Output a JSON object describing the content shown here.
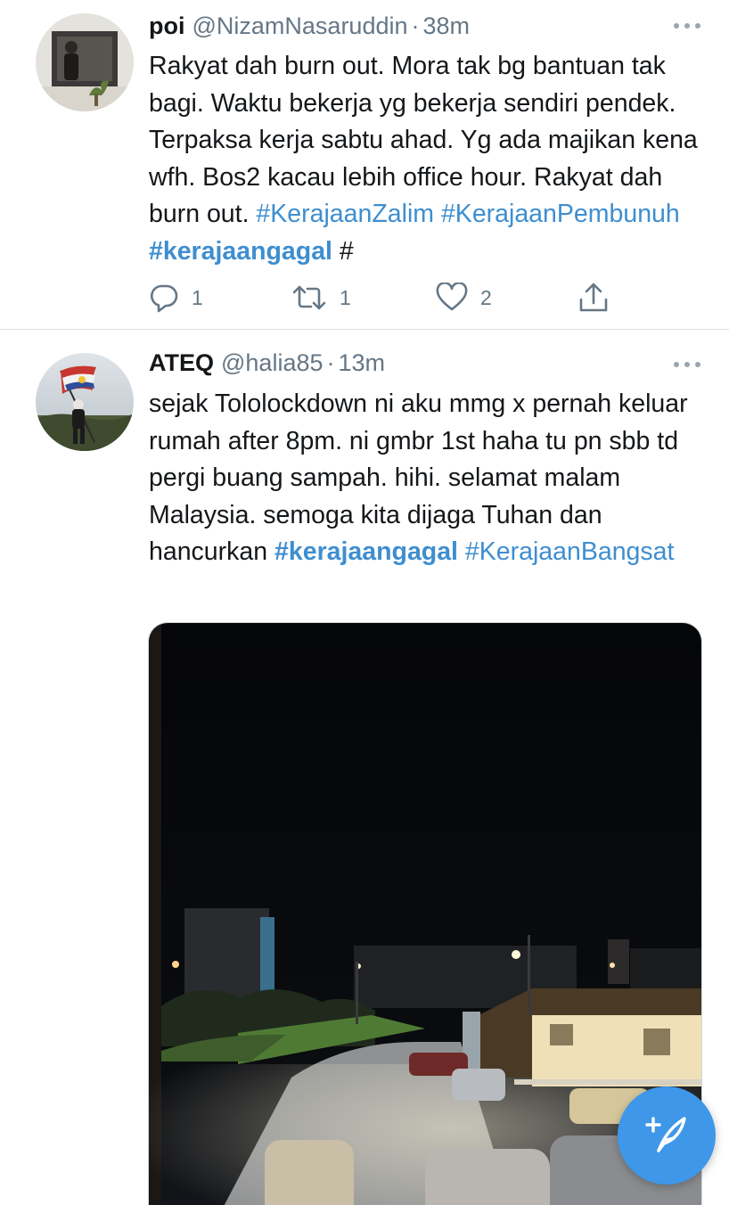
{
  "tweets": [
    {
      "name": "poi",
      "handle": "@NizamNasaruddin",
      "separator": "·",
      "time": "38m",
      "text_segments": [
        "Rakyat dah burn out. Mora tak bg bantuan tak bagi. Waktu bekerja yg bekerja sendiri pendek. Terpaksa kerja sabtu ahad. Yg ada majikan kena wfh. Bos2 kacau lebih office hour. Rakyat dah burn out. ",
        "#KerajaanZalim",
        " ",
        "#KerajaanPembunuh",
        " ",
        "#kerajaangagal",
        " #"
      ],
      "actions": {
        "reply_count": "1",
        "retweet_count": "1",
        "like_count": "2"
      }
    },
    {
      "name": "ATEQ",
      "handle": "@halia85",
      "separator": "·",
      "time": "13m",
      "text_segments": [
        "sejak Tololockdown ni aku mmg x pernah keluar rumah after 8pm. ni gmbr 1st haha tu pn sbb td pergi buang sampah. hihi. selamat malam Malaysia. semoga kita dijaga Tuhan dan hancurkan ",
        "#kerajaangagal",
        " ",
        "#KerajaanBangsat"
      ]
    }
  ],
  "icons": {
    "more": "more-dots-icon",
    "reply": "reply-bubble-icon",
    "retweet": "retweet-arrows-icon",
    "like": "heart-icon",
    "share": "share-upload-icon",
    "compose": "compose-feather-plus-icon"
  },
  "colors": {
    "link": "#3e8ed0",
    "secondary_text": "#657786",
    "fab": "#3f97e9",
    "divider": "#dfe3e6"
  }
}
